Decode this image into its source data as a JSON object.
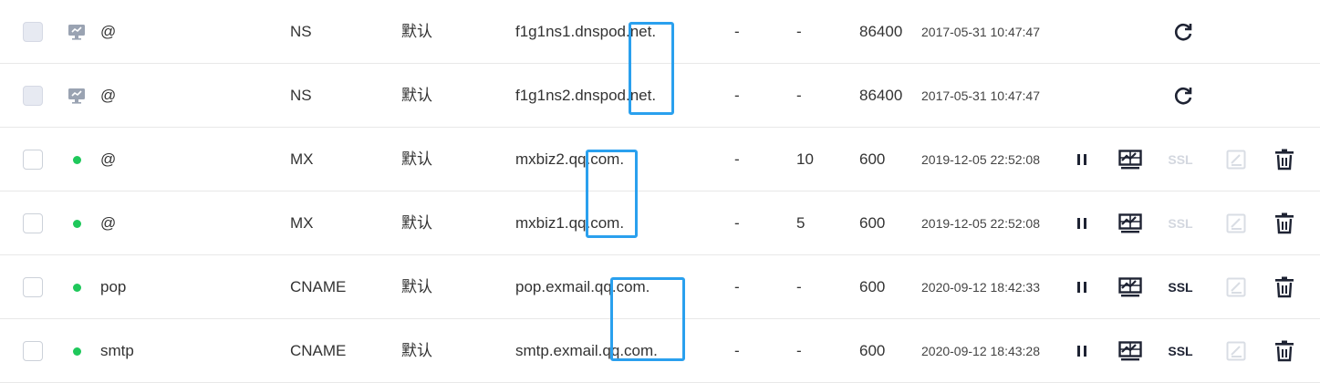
{
  "rows": [
    {
      "checkbox_disabled": true,
      "status": "system",
      "host": "@",
      "type": "NS",
      "line": "默认",
      "value": "f1g1ns1.dnspod.net.",
      "weight": "-",
      "mx": "-",
      "ttl": "86400",
      "updated": "2017-05-31 10:47:47",
      "actions": "refresh"
    },
    {
      "checkbox_disabled": true,
      "status": "system",
      "host": "@",
      "type": "NS",
      "line": "默认",
      "value": "f1g1ns2.dnspod.net.",
      "weight": "-",
      "mx": "-",
      "ttl": "86400",
      "updated": "2017-05-31 10:47:47",
      "actions": "refresh"
    },
    {
      "checkbox_disabled": false,
      "status": "enabled",
      "host": "@",
      "type": "MX",
      "line": "默认",
      "value": "mxbiz2.qq.com.",
      "weight": "-",
      "mx": "10",
      "ttl": "600",
      "updated": "2019-12-05 22:52:08",
      "actions": "full",
      "ssl_enabled": false
    },
    {
      "checkbox_disabled": false,
      "status": "enabled",
      "host": "@",
      "type": "MX",
      "line": "默认",
      "value": "mxbiz1.qq.com.",
      "weight": "-",
      "mx": "5",
      "ttl": "600",
      "updated": "2019-12-05 22:52:08",
      "actions": "full",
      "ssl_enabled": false
    },
    {
      "checkbox_disabled": false,
      "status": "enabled",
      "host": "pop",
      "type": "CNAME",
      "line": "默认",
      "value": "pop.exmail.qq.com.",
      "weight": "-",
      "mx": "-",
      "ttl": "600",
      "updated": "2020-09-12 18:42:33",
      "actions": "full",
      "ssl_enabled": true
    },
    {
      "checkbox_disabled": false,
      "status": "enabled",
      "host": "smtp",
      "type": "CNAME",
      "line": "默认",
      "value": "smtp.exmail.qq.com.",
      "weight": "-",
      "mx": "-",
      "ttl": "600",
      "updated": "2020-09-12 18:43:28",
      "actions": "full",
      "ssl_enabled": true
    }
  ],
  "ssl_label": "SSL",
  "colors": {
    "status_dot": "#1fc85b",
    "highlight": "#2aa0ee",
    "icon_dark": "#1e2333",
    "icon_disabled": "#d3d7df"
  },
  "icons": {
    "system": "monitor-icon",
    "pause": "pause-icon",
    "monitor": "monitor-action-icon",
    "edit": "edit-note-icon",
    "delete": "trash-icon",
    "refresh": "refresh-icon"
  }
}
